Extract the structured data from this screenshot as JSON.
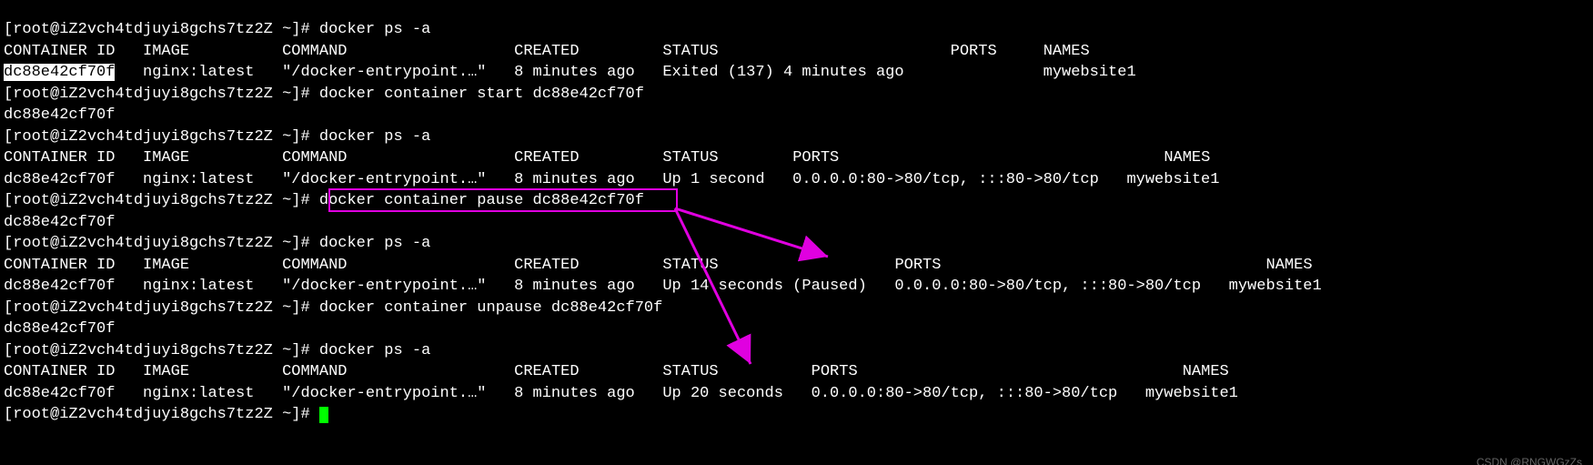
{
  "prompt_host": "root@iZ2vch4tdjuyi8gchs7tz2Z",
  "prompt_cwd": "~",
  "commands": {
    "ps": "docker ps -a",
    "start": "docker container start dc88e42cf70f",
    "pause": "docker container pause dc88e42cf70f",
    "unpause": "docker container unpause dc88e42cf70f"
  },
  "container_id_short": "dc88e42cf70f",
  "headers": {
    "id": "CONTAINER ID",
    "image": "IMAGE",
    "command": "COMMAND",
    "created": "CREATED",
    "status": "STATUS",
    "ports": "PORTS",
    "names": "NAMES"
  },
  "vals": {
    "image": "nginx:latest",
    "command": "\"/docker-entrypoint.…\"",
    "created": "8 minutes ago",
    "name": "mywebsite1",
    "status_exited": "Exited (137) 4 minutes ago",
    "status_up1": "Up 1 second",
    "status_up14p": "Up 14 seconds (Paused)",
    "status_up20": "Up 20 seconds",
    "ports_full": "0.0.0.0:80->80/tcp, :::80->80/tcp"
  },
  "watermark": "CSDN @RNGWGzZs"
}
